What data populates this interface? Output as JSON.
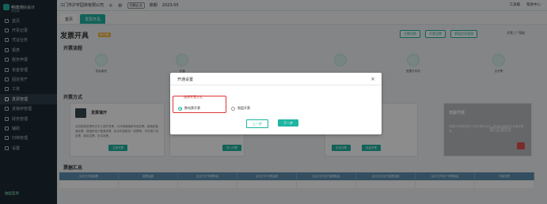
{
  "sidebar": {
    "brand": "畅捷通好会计",
    "brand_sub": "专业版",
    "items": [
      {
        "label": "首页"
      },
      {
        "label": "开票记录"
      },
      {
        "label": "凭证业务"
      },
      {
        "label": "报表"
      },
      {
        "label": "税务申报"
      },
      {
        "label": "资金管理"
      },
      {
        "label": "固定资产"
      },
      {
        "label": "工资"
      },
      {
        "label": "发票管理"
      },
      {
        "label": "进销存管理"
      },
      {
        "label": "财务管理"
      },
      {
        "label": "辅助"
      },
      {
        "label": "归档管理"
      },
      {
        "label": "设置"
      }
    ],
    "active_index": 8,
    "footer": "收起菜单"
  },
  "topbar": {
    "company": "江门市沪字园林有限公司",
    "badge": "切换企业",
    "tax_label": "账期",
    "period": "2023-05",
    "right_items": [
      "工具箱",
      "帮助中心"
    ]
  },
  "tabs": [
    {
      "label": "首页"
    },
    {
      "label": "发票开具"
    }
  ],
  "page": {
    "title": "发票开具",
    "title_tag": "新功能",
    "actions": [
      "主题切换",
      "开票设置",
      "票面信息管理"
    ],
    "icons_label": "开票 | ? 帮助"
  },
  "flow": {
    "title": "开票流程",
    "items": [
      {
        "label": "购买服务"
      },
      {
        "label": "开通"
      },
      {
        "label": ""
      },
      {
        "label": ""
      },
      {
        "label": ""
      },
      {
        "label": ""
      },
      {
        "label": "配置打印机"
      },
      {
        "label": "去开票"
      }
    ]
  },
  "methods": {
    "title": "开票方式",
    "cards": [
      {
        "title": "发票填开",
        "desc": "支持按照发票样式手工填开发票，可开具增值税专用发票、增值税普通发票、增值税电子普通发票、机动车销售统一发票等，可开具产品发票、服务发票、折扣发票。",
        "button": "立即开票"
      },
      {
        "title": "批量开票",
        "desc": "自动导入。",
        "button": "导入开票"
      },
      {
        "title": "",
        "desc": "",
        "buttons": [
          "手动开票",
          "批量开票"
        ]
      },
      {
        "title": "老版开票",
        "desc": "需要将开票数据导入到开票系统中，再开出专用电子普通发票等。",
        "coming": "敬请期待"
      }
    ]
  },
  "summary": {
    "title": "票据汇总",
    "columns": [
      "当月已开普通票",
      "普票金额",
      "全月已开专票数量",
      "全月已开专票金额",
      "全月已开电子普票数量",
      "全月已开电子普票金额",
      "全月已开电子专票数量",
      "作废发票"
    ]
  },
  "modal": {
    "title": "开通设置",
    "close": "×",
    "section_label": "选择开票方式",
    "options": [
      {
        "label": "数电票开票",
        "checked": true
      },
      {
        "label": "税盘开票",
        "checked": false
      }
    ],
    "prev_label": "上一步",
    "next_label": "下一步"
  },
  "colors": {
    "accent": "#1fb5a3",
    "sidebar": "#1d2a33",
    "highlight": "#d33333"
  }
}
